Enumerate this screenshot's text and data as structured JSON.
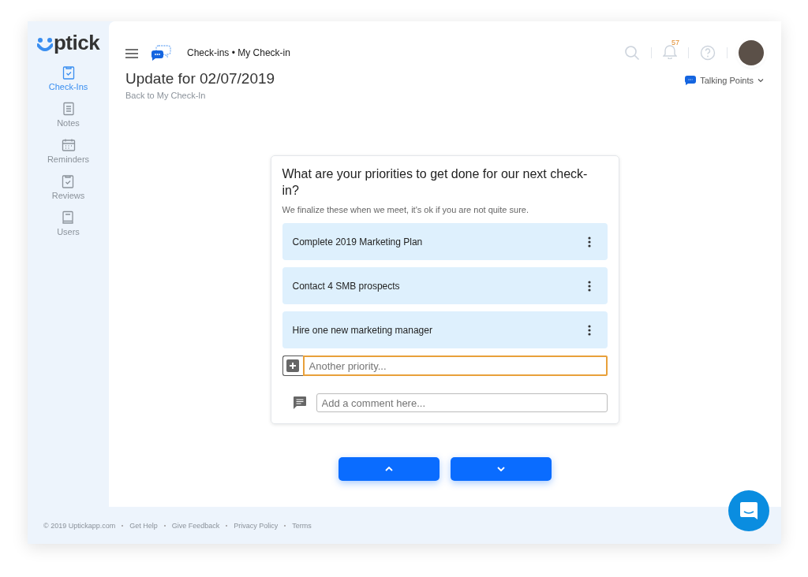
{
  "logo": {
    "text": "ptick"
  },
  "sidebar": {
    "items": [
      {
        "label": "Check-Ins",
        "kind": "clipboard",
        "selected": true
      },
      {
        "label": "Notes",
        "kind": "notes",
        "selected": false
      },
      {
        "label": "Reminders",
        "kind": "calendar",
        "selected": false
      },
      {
        "label": "Reviews",
        "kind": "clipboard",
        "selected": false
      },
      {
        "label": "Users",
        "kind": "book",
        "selected": false
      }
    ]
  },
  "header": {
    "breadcrumb": "Check-ins • My Check-in",
    "title": "Update for 02/07/2019",
    "back_link": "Back to My Check-In",
    "notification_count": "57",
    "talking_points": "Talking Points"
  },
  "card": {
    "question": "What are your priorities to get done for our next check-in?",
    "hint": "We finalize these when we meet, it's ok if you are not quite sure.",
    "priorities": [
      {
        "text": "Complete 2019 Marketing Plan"
      },
      {
        "text": "Contact 4 SMB prospects"
      },
      {
        "text": "Hire one new marketing manager"
      }
    ],
    "new_priority": {
      "placeholder": "Another priority...",
      "focused": true
    },
    "comment": {
      "placeholder": "Add a comment here..."
    }
  },
  "footer": {
    "links": [
      "© 2019 Uptickapp.com",
      "Get Help",
      "Give Feedback",
      "Privacy Policy",
      "Terms"
    ]
  }
}
